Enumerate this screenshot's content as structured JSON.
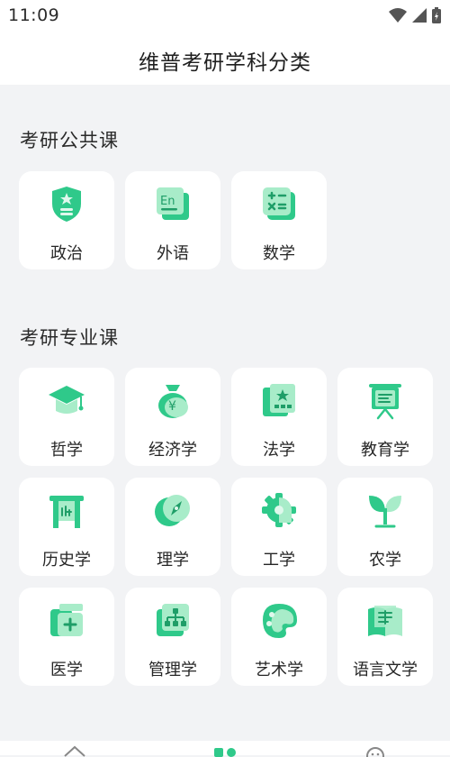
{
  "status_bar": {
    "time": "11:09"
  },
  "header": {
    "title": "维普考研学科分类"
  },
  "sections": [
    {
      "title": "考研公共课",
      "items": [
        {
          "label": "政治",
          "icon": "shield-star-icon"
        },
        {
          "label": "外语",
          "icon": "english-book-icon"
        },
        {
          "label": "数学",
          "icon": "calculator-icon"
        }
      ]
    },
    {
      "title": "考研专业课",
      "items": [
        {
          "label": "哲学",
          "icon": "graduation-cap-icon"
        },
        {
          "label": "经济学",
          "icon": "money-bag-icon"
        },
        {
          "label": "法学",
          "icon": "law-book-icon"
        },
        {
          "label": "教育学",
          "icon": "blackboard-icon"
        },
        {
          "label": "历史学",
          "icon": "history-gate-icon"
        },
        {
          "label": "理学",
          "icon": "compass-icon"
        },
        {
          "label": "工学",
          "icon": "gear-icon"
        },
        {
          "label": "农学",
          "icon": "sprout-icon"
        },
        {
          "label": "医学",
          "icon": "medicine-bottle-icon"
        },
        {
          "label": "管理学",
          "icon": "org-chart-icon"
        },
        {
          "label": "艺术学",
          "icon": "palette-icon"
        },
        {
          "label": "语言文学",
          "icon": "open-book-icon"
        }
      ]
    }
  ],
  "colors": {
    "accent": "#2fc98a",
    "accent_light": "#a8ecc9",
    "background": "#f2f3f5"
  },
  "bottom_nav": {
    "icons": [
      "home-icon",
      "category-icon",
      "profile-icon"
    ]
  }
}
